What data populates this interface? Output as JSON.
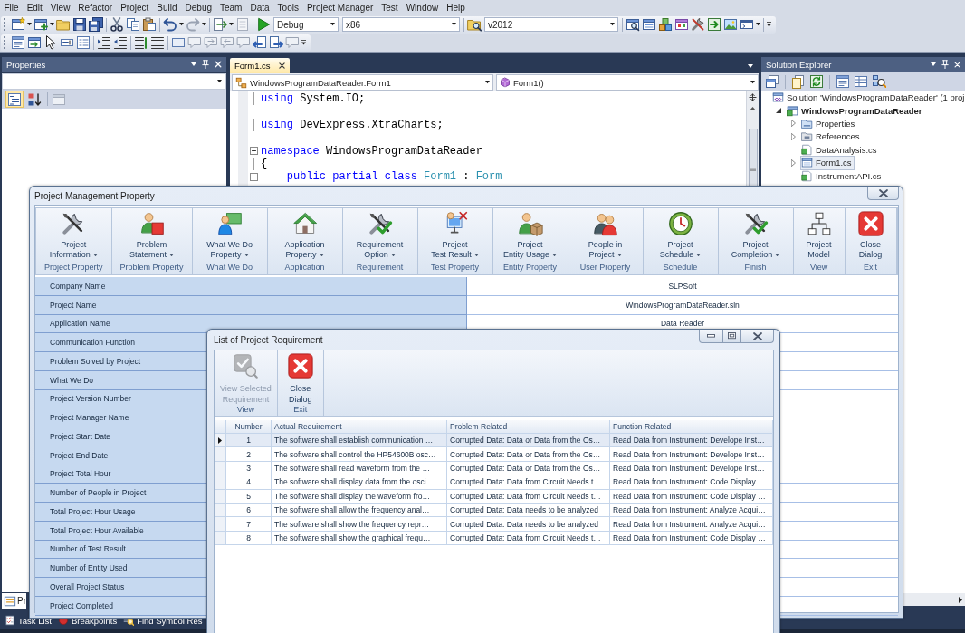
{
  "menu_bar": {
    "items": [
      "File",
      "Edit",
      "View",
      "Refactor",
      "Project",
      "Build",
      "Debug",
      "Team",
      "Data",
      "Tools",
      "Project Manager",
      "Test",
      "Window",
      "Help"
    ]
  },
  "toolbar": {
    "configuration": "Debug",
    "platform": "x86",
    "version": "v2012"
  },
  "properties_panel": {
    "title": "Properties",
    "view_buttons": [
      {
        "selected": true
      },
      {
        "selected": false
      }
    ],
    "tabs": [
      {
        "label": "Pr",
        "selected": true
      }
    ]
  },
  "editor": {
    "tabs": [
      {
        "label": "Form1.cs",
        "selected": true
      }
    ],
    "type_selector": "WindowsProgramDataReader.Form1",
    "member_selector": "Form1()",
    "lines": [
      {
        "kind": "code",
        "tokens": [
          {
            "text": "using",
            "kind": "keyword"
          },
          {
            "text": " System.IO;",
            "kind": "plain"
          }
        ]
      },
      {
        "kind": "blank"
      },
      {
        "kind": "code",
        "tokens": [
          {
            "text": "using",
            "kind": "keyword"
          },
          {
            "text": " DevExpress.XtraCharts;",
            "kind": "plain"
          }
        ]
      },
      {
        "kind": "blank"
      },
      {
        "kind": "code",
        "collapsible": true,
        "tokens": [
          {
            "text": "namespace",
            "kind": "keyword"
          },
          {
            "text": " WindowsProgramDataReader",
            "kind": "plain"
          }
        ]
      },
      {
        "kind": "code",
        "tokens": [
          {
            "text": "{",
            "kind": "plain"
          }
        ]
      },
      {
        "kind": "code",
        "collapsible": true,
        "tokens": [
          {
            "text": "    public",
            "kind": "keyword"
          },
          {
            "text": " partial",
            "kind": "keyword"
          },
          {
            "text": " class",
            "kind": "keyword"
          },
          {
            "text": " Form1",
            "kind": "type"
          },
          {
            "text": " : ",
            "kind": "plain"
          },
          {
            "text": "Form",
            "kind": "type"
          }
        ]
      }
    ]
  },
  "solution_explorer": {
    "title": "Solution Explorer",
    "tree": [
      {
        "label": "Solution 'WindowsProgramDataReader' (1 proj",
        "kind": "solution",
        "selected": false,
        "children": [
          {
            "label": "WindowsProgramDataReader",
            "kind": "project",
            "expanded": true,
            "selected": false,
            "children": [
              {
                "label": "Properties",
                "kind": "properties",
                "expanded": false,
                "selected": false
              },
              {
                "label": "References",
                "kind": "references",
                "expanded": false,
                "selected": false
              },
              {
                "label": "DataAnalysis.cs",
                "kind": "code",
                "selected": false
              },
              {
                "label": "Form1.cs",
                "kind": "form",
                "expanded": false,
                "selected": true
              },
              {
                "label": "InstrumentAPI.cs",
                "kind": "code",
                "selected": false
              }
            ]
          }
        ]
      }
    ]
  },
  "bottom_tabs": [
    {
      "label": "Task List"
    },
    {
      "label": "Breakpoints"
    },
    {
      "label": "Find Symbol Res"
    }
  ],
  "project_dialog": {
    "title": "Project Management Property",
    "ribbon": [
      {
        "lines": [
          "Project",
          "Information"
        ],
        "dropdown": true,
        "group": "Project Property"
      },
      {
        "lines": [
          "Problem",
          "Statement"
        ],
        "dropdown": true,
        "group": "Problem Property"
      },
      {
        "lines": [
          "What We Do",
          "Property"
        ],
        "dropdown": true,
        "group": "What We Do"
      },
      {
        "lines": [
          "Application",
          "Property"
        ],
        "dropdown": true,
        "group": "Application"
      },
      {
        "lines": [
          "Requirement",
          "Option"
        ],
        "dropdown": true,
        "group": "Requirement"
      },
      {
        "lines": [
          "Project",
          "Test Result"
        ],
        "dropdown": true,
        "group": "Test Property"
      },
      {
        "lines": [
          "Project",
          "Entity Usage"
        ],
        "dropdown": true,
        "group": "Entity Property"
      },
      {
        "lines": [
          "People in",
          "Project"
        ],
        "dropdown": true,
        "group": "User Property"
      },
      {
        "lines": [
          "Project",
          "Schedule"
        ],
        "dropdown": true,
        "group": "Schedule"
      },
      {
        "lines": [
          "Project",
          "Completion"
        ],
        "dropdown": true,
        "group": "Finish"
      },
      {
        "lines": [
          "Project",
          "Model"
        ],
        "dropdown": false,
        "group": "View"
      },
      {
        "lines": [
          "Close",
          "Dialog"
        ],
        "dropdown": false,
        "group": "Exit"
      }
    ],
    "properties": [
      {
        "label": "Company Name",
        "value": "SLPSoft"
      },
      {
        "label": "Project Name",
        "value": "WindowsProgramDataReader.sln"
      },
      {
        "label": "Application Name",
        "value": "Data Reader"
      },
      {
        "label": "Communication Function"
      },
      {
        "label": "Problem Solved by Project"
      },
      {
        "label": "What We Do"
      },
      {
        "label": "Project Version Number"
      },
      {
        "label": "Project Manager Name"
      },
      {
        "label": "Project Start Date"
      },
      {
        "label": "Project End Date"
      },
      {
        "label": "Project Total Hour"
      },
      {
        "label": "Number of People in Project"
      },
      {
        "label": "Total Project Hour Usage"
      },
      {
        "label": "Total Project Hour Available"
      },
      {
        "label": "Number of Test Result"
      },
      {
        "label": "Number of Entity Used"
      },
      {
        "label": "Overall Project Status"
      },
      {
        "label": "Project Completed"
      }
    ]
  },
  "requirement_dialog": {
    "title": "List of Project Requirement",
    "ribbon": [
      {
        "lines": [
          "View Selected",
          "Requirement"
        ],
        "disabled": true,
        "group": "View"
      },
      {
        "lines": [
          "Close",
          "Dialog"
        ],
        "disabled": false,
        "group": "Exit"
      }
    ],
    "table": {
      "columns": [
        "Number",
        "Actual Requirement",
        "Problem Related",
        "Function Related"
      ],
      "rows": [
        {
          "selected": true,
          "cells": [
            "1",
            "The software shall establish communication …",
            "Corrupted Data: Data or Data from the Os…",
            "Read Data from Instrument: Develope Inst…"
          ]
        },
        {
          "selected": false,
          "cells": [
            "2",
            "The software shall control the HP54600B osc…",
            "Corrupted Data: Data or Data from the Os…",
            "Read Data from Instrument: Develope Inst…"
          ]
        },
        {
          "selected": false,
          "cells": [
            "3",
            "The software shall read waveform from the …",
            "Corrupted Data: Data or Data from the Os…",
            "Read Data from Instrument: Develope Inst…"
          ]
        },
        {
          "selected": false,
          "cells": [
            "4",
            "The software shall display data from the osci…",
            "Corrupted Data: Data from Circuit Needs t…",
            "Read Data from Instrument: Code Display …"
          ]
        },
        {
          "selected": false,
          "cells": [
            "5",
            "The software shall display the waveform fro…",
            "Corrupted Data: Data from Circuit Needs t…",
            "Read Data from Instrument: Code Display …"
          ]
        },
        {
          "selected": false,
          "cells": [
            "6",
            "The software shall allow the frequency anal…",
            "Corrupted Data: Data needs to be analyzed",
            "Read Data from Instrument: Analyze Acqui…"
          ]
        },
        {
          "selected": false,
          "cells": [
            "7",
            "The software shall show the frequency repr…",
            "Corrupted Data: Data needs to be analyzed",
            "Read Data from Instrument: Analyze Acqui…"
          ]
        },
        {
          "selected": false,
          "cells": [
            "8",
            "The software shall show the graphical frequ…",
            "Corrupted Data: Data from Circuit Needs t…",
            "Read Data from Instrument: Code Display …"
          ]
        }
      ]
    }
  }
}
